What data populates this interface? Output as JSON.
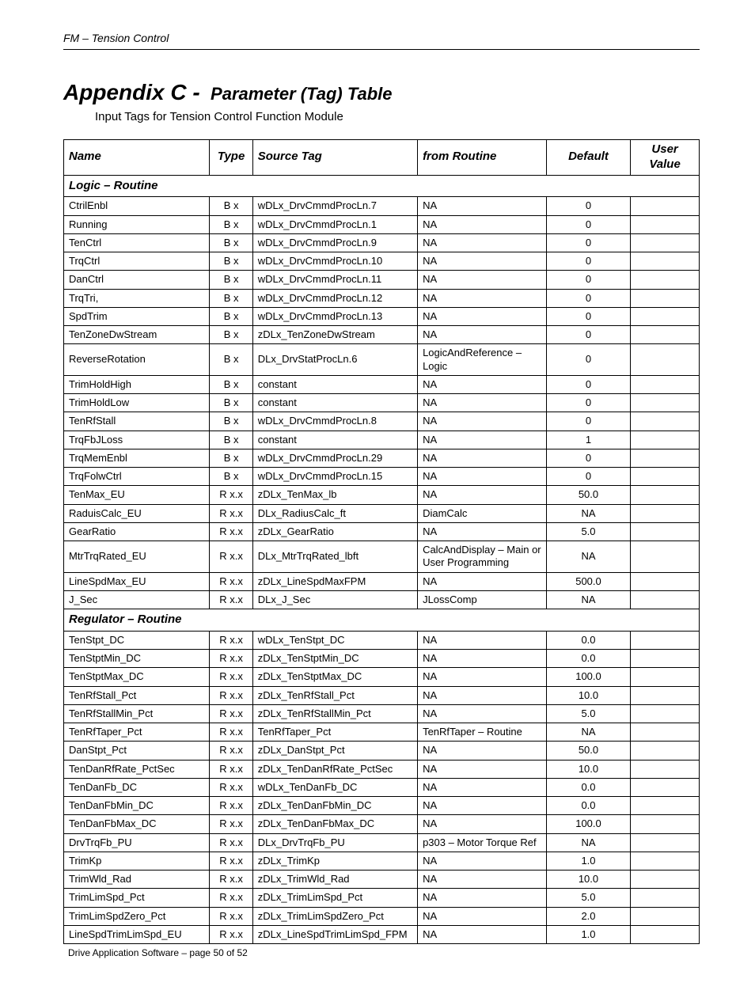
{
  "header_label": "FM – Tension Control",
  "title_prefix": "Appendix C -",
  "title_main": "Parameter (Tag) Table",
  "subtitle": "Input Tags for Tension Control Function Module",
  "columns": {
    "name": "Name",
    "type": "Type",
    "source": "Source Tag",
    "routine": "from Routine",
    "default": "Default",
    "user": "User Value"
  },
  "sections": [
    {
      "title": "Logic – Routine",
      "rows": [
        {
          "name": "CtrilEnbl",
          "type": "B x",
          "src": "wDLx_DrvCmmdProcLn.7",
          "route": "NA",
          "def": "0"
        },
        {
          "name": "Running",
          "type": "B x",
          "src": "wDLx_DrvCmmdProcLn.1",
          "route": "NA",
          "def": "0"
        },
        {
          "name": "TenCtrl",
          "type": "B x",
          "src": "wDLx_DrvCmmdProcLn.9",
          "route": "NA",
          "def": "0"
        },
        {
          "name": "TrqCtrl",
          "type": "B x",
          "src": "wDLx_DrvCmmdProcLn.10",
          "route": "NA",
          "def": "0"
        },
        {
          "name": "DanCtrl",
          "type": "B x",
          "src": "wDLx_DrvCmmdProcLn.11",
          "route": "NA",
          "def": "0"
        },
        {
          "name": "TrqTri,",
          "type": "B x",
          "src": "wDLx_DrvCmmdProcLn.12",
          "route": "NA",
          "def": "0"
        },
        {
          "name": "SpdTrim",
          "type": "B x",
          "src": "wDLx_DrvCmmdProcLn.13",
          "route": "NA",
          "def": "0"
        },
        {
          "name": "TenZoneDwStream",
          "type": "B x",
          "src": "zDLx_TenZoneDwStream",
          "route": "NA",
          "def": "0"
        },
        {
          "name": "ReverseRotation",
          "type": "B x",
          "src": "DLx_DrvStatProcLn.6",
          "route": "LogicAndReference – Logic",
          "def": "0"
        },
        {
          "name": "TrimHoldHigh",
          "type": "B x",
          "src": "constant",
          "route": "NA",
          "def": "0"
        },
        {
          "name": "TrimHoldLow",
          "type": "B x",
          "src": "constant",
          "route": "NA",
          "def": "0"
        },
        {
          "name": "TenRfStall",
          "type": "B x",
          "src": "wDLx_DrvCmmdProcLn.8",
          "route": "NA",
          "def": "0"
        },
        {
          "name": "TrqFbJLoss",
          "type": "B x",
          "src": "constant",
          "route": "NA",
          "def": "1"
        },
        {
          "name": "TrqMemEnbl",
          "type": "B x",
          "src": "wDLx_DrvCmmdProcLn.29",
          "route": "NA",
          "def": "0"
        },
        {
          "name": "TrqFolwCtrl",
          "type": "B x",
          "src": "wDLx_DrvCmmdProcLn.15",
          "route": "NA",
          "def": "0"
        },
        {
          "name": "TenMax_EU",
          "type": "R x.x",
          "src": "zDLx_TenMax_lb",
          "route": "NA",
          "def": "50.0"
        },
        {
          "name": "RaduisCalc_EU",
          "type": "R x.x",
          "src": "DLx_RadiusCalc_ft",
          "route": "DiamCalc",
          "def": "NA"
        },
        {
          "name": "GearRatio",
          "type": "R x.x",
          "src": "zDLx_GearRatio",
          "route": "NA",
          "def": "5.0"
        },
        {
          "name": "MtrTrqRated_EU",
          "type": "R x.x",
          "src": "DLx_MtrTrqRated_lbft",
          "route": "CalcAndDisplay – Main or User Programming",
          "def": "NA"
        },
        {
          "name": "LineSpdMax_EU",
          "type": "R x.x",
          "src": "zDLx_LineSpdMaxFPM",
          "route": "NA",
          "def": "500.0"
        },
        {
          "name": "J_Sec",
          "type": "R x.x",
          "src": "DLx_J_Sec",
          "route": "JLossComp",
          "def": "NA"
        }
      ]
    },
    {
      "title": "Regulator – Routine",
      "rows": [
        {
          "name": "TenStpt_DC",
          "type": "R x.x",
          "src": "wDLx_TenStpt_DC",
          "route": "NA",
          "def": "0.0"
        },
        {
          "name": "TenStptMin_DC",
          "type": "R x.x",
          "src": "zDLx_TenStptMin_DC",
          "route": "NA",
          "def": "0.0"
        },
        {
          "name": "TenStptMax_DC",
          "type": "R x.x",
          "src": "zDLx_TenStptMax_DC",
          "route": "NA",
          "def": "100.0"
        },
        {
          "name": "TenRfStall_Pct",
          "type": "R x.x",
          "src": "zDLx_TenRfStall_Pct",
          "route": "NA",
          "def": "10.0"
        },
        {
          "name": "TenRfStallMin_Pct",
          "type": "R x.x",
          "src": "zDLx_TenRfStallMin_Pct",
          "route": "NA",
          "def": "5.0"
        },
        {
          "name": "TenRfTaper_Pct",
          "type": "R x.x",
          "src": "TenRfTaper_Pct",
          "route": "TenRfTaper – Routine",
          "def": "NA"
        },
        {
          "name": "DanStpt_Pct",
          "type": "R x.x",
          "src": "zDLx_DanStpt_Pct",
          "route": "NA",
          "def": "50.0"
        },
        {
          "name": "TenDanRfRate_PctSec",
          "type": "R x.x",
          "src": "zDLx_TenDanRfRate_PctSec",
          "route": "NA",
          "def": "10.0"
        },
        {
          "name": "TenDanFb_DC",
          "type": "R x.x",
          "src": "wDLx_TenDanFb_DC",
          "route": "NA",
          "def": "0.0"
        },
        {
          "name": "TenDanFbMin_DC",
          "type": "R x.x",
          "src": "zDLx_TenDanFbMin_DC",
          "route": "NA",
          "def": "0.0"
        },
        {
          "name": "TenDanFbMax_DC",
          "type": "R x.x",
          "src": "zDLx_TenDanFbMax_DC",
          "route": "NA",
          "def": "100.0"
        },
        {
          "name": "DrvTrqFb_PU",
          "type": "R x.x",
          "src": "DLx_DrvTrqFb_PU",
          "route": "p303 – Motor Torque Ref",
          "def": "NA"
        },
        {
          "name": "TrimKp",
          "type": "R x.x",
          "src": "zDLx_TrimKp",
          "route": "NA",
          "def": "1.0"
        },
        {
          "name": "TrimWld_Rad",
          "type": "R x.x",
          "src": "zDLx_TrimWld_Rad",
          "route": "NA",
          "def": "10.0"
        },
        {
          "name": "TrimLimSpd_Pct",
          "type": "R x.x",
          "src": "zDLx_TrimLimSpd_Pct",
          "route": "NA",
          "def": "5.0"
        },
        {
          "name": "TrimLimSpdZero_Pct",
          "type": "R x.x",
          "src": "zDLx_TrimLimSpdZero_Pct",
          "route": "NA",
          "def": "2.0"
        },
        {
          "name": "LineSpdTrimLimSpd_EU",
          "type": "R x.x",
          "src": "zDLx_LineSpdTrimLimSpd_FPM",
          "route": "NA",
          "def": "1.0"
        }
      ]
    }
  ],
  "footer": "Drive Application Software – page 50 of 52"
}
